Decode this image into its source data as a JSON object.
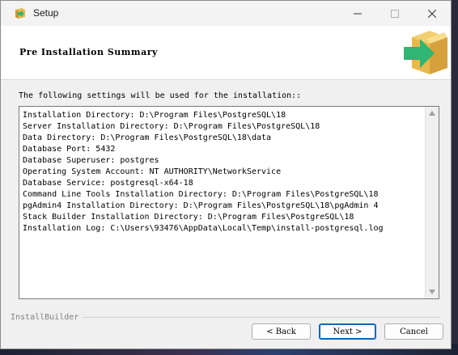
{
  "window": {
    "title": "Setup"
  },
  "header": {
    "title": "Pre Installation Summary"
  },
  "content": {
    "intro": "The following settings will be used for the installation::",
    "summary_lines": [
      "Installation Directory: D:\\Program Files\\PostgreSQL\\18",
      "Server Installation Directory: D:\\Program Files\\PostgreSQL\\18",
      "Data Directory: D:\\Program Files\\PostgreSQL\\18\\data",
      "Database Port: 5432",
      "Database Superuser: postgres",
      "Operating System Account: NT AUTHORITY\\NetworkService",
      "Database Service: postgresql-x64-18",
      "Command Line Tools Installation Directory: D:\\Program Files\\PostgreSQL\\18",
      "pgAdmin4 Installation Directory: D:\\Program Files\\PostgreSQL\\18\\pgAdmin 4",
      "Stack Builder Installation Directory: D:\\Program Files\\PostgreSQL\\18",
      "Installation Log: C:\\Users\\93476\\AppData\\Local\\Temp\\install-postgresql.log"
    ]
  },
  "footer": {
    "brand": "InstallBuilder",
    "back_label": "< Back",
    "next_label": "Next >",
    "cancel_label": "Cancel"
  },
  "icons": {
    "app": "installer-box-icon",
    "header": "installer-box-icon",
    "minimize": "minimize-icon",
    "maximize": "maximize-icon",
    "close": "close-icon"
  },
  "colors": {
    "box_tan": "#e8b84a",
    "arrow_green": "#2fb574",
    "default_button_border": "#0067c0"
  }
}
